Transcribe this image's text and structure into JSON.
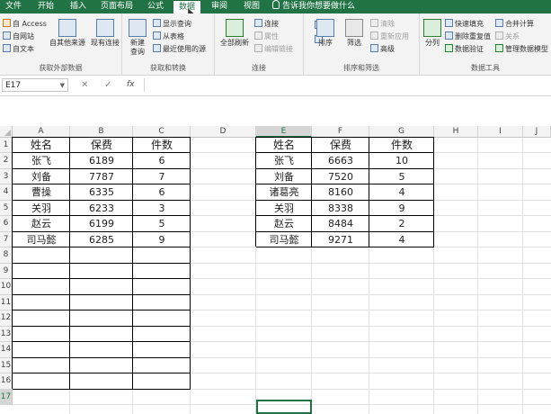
{
  "tabs": [
    "文件",
    "开始",
    "插入",
    "页面布局",
    "公式",
    "数据",
    "审阅",
    "视图"
  ],
  "active_tab": "数据",
  "tell_me": "告诉我你想要做什么",
  "ribbon": {
    "external": {
      "label": "获取外部数据",
      "access": "自 Access",
      "web": "自网站",
      "text": "自文本",
      "other_sources": "自其他来源",
      "existing": "现有连接"
    },
    "transform": {
      "label": "获取和转换",
      "new_query": "新建\n查询",
      "show_query": "显示查询",
      "from_table": "从表格",
      "recent": "最近使用的源"
    },
    "connections": {
      "label": "连接",
      "refresh_all": "全部刷新",
      "connections": "连接",
      "properties": "属性",
      "edit_links": "编辑链接"
    },
    "sort_filter": {
      "label": "排序和筛选",
      "sort": "排序",
      "filter": "筛选",
      "clear": "清除",
      "reapply": "重新应用",
      "advanced": "高级"
    },
    "data_tools": {
      "label": "数据工具",
      "split": "分列",
      "flash_fill": "快速填充",
      "remove_dup": "删除重复值",
      "validation": "数据验证",
      "consolidate": "合并计算",
      "relations": "关系",
      "manage_model": "管理数据模型"
    }
  },
  "formula_bar": {
    "name_box": "E17",
    "cancel": "✕",
    "enter": "✓",
    "fx": "fx",
    "content": ""
  },
  "columns": [
    "A",
    "B",
    "C",
    "D",
    "E",
    "F",
    "G",
    "H",
    "I",
    "J"
  ],
  "rows": [
    "1",
    "2",
    "3",
    "4",
    "5",
    "6",
    "7",
    "8",
    "9",
    "10",
    "11",
    "12",
    "13",
    "14",
    "15",
    "16",
    "17"
  ],
  "selected_cell": "E17",
  "table1": {
    "headers": [
      "姓名",
      "保费",
      "件数"
    ],
    "rows": [
      [
        "张飞",
        "6189",
        "6"
      ],
      [
        "刘备",
        "7787",
        "7"
      ],
      [
        "曹操",
        "6335",
        "6"
      ],
      [
        "关羽",
        "6233",
        "3"
      ],
      [
        "赵云",
        "6199",
        "5"
      ],
      [
        "司马懿",
        "6285",
        "9"
      ]
    ]
  },
  "table2": {
    "headers": [
      "姓名",
      "保费",
      "件数"
    ],
    "rows": [
      [
        "张飞",
        "6663",
        "10"
      ],
      [
        "刘备",
        "7520",
        "5"
      ],
      [
        "诸葛亮",
        "8160",
        "4"
      ],
      [
        "关羽",
        "8338",
        "9"
      ],
      [
        "赵云",
        "8484",
        "2"
      ],
      [
        "司马懿",
        "9271",
        "4"
      ]
    ]
  },
  "colors": {
    "accent": "#217346",
    "grid": "#e1e1e1",
    "header_bg": "#f3f3f3"
  }
}
